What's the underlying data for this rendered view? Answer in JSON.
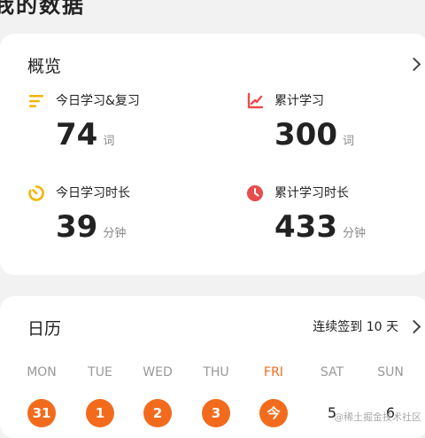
{
  "page": {
    "title": "我的数据"
  },
  "overview": {
    "title": "概览",
    "stats": [
      {
        "label": "今日学习&复习",
        "value": "74",
        "unit": "词",
        "icon": "list-lines-icon",
        "color": "#f5b400"
      },
      {
        "label": "累计学习",
        "value": "300",
        "unit": "词",
        "icon": "line-chart-icon",
        "color": "#e84c4c"
      },
      {
        "label": "今日学习时长",
        "value": "39",
        "unit": "分钟",
        "icon": "progress-ring-icon",
        "color": "#f5b400"
      },
      {
        "label": "累计学习时长",
        "value": "433",
        "unit": "分钟",
        "icon": "clock-icon",
        "color": "#e84c4c"
      }
    ]
  },
  "calendar": {
    "title": "日历",
    "streak": "连续签到 10 天",
    "weekdays": [
      "MON",
      "TUE",
      "WED",
      "THU",
      "FRI",
      "SAT",
      "SUN"
    ],
    "today_index": 4,
    "days": [
      {
        "label": "31",
        "checked": true
      },
      {
        "label": "1",
        "checked": true
      },
      {
        "label": "2",
        "checked": true
      },
      {
        "label": "3",
        "checked": true
      },
      {
        "label": "今",
        "checked": true
      },
      {
        "label": "5",
        "checked": false
      },
      {
        "label": "6",
        "checked": false
      }
    ],
    "accent": "#f26b1d"
  },
  "watermark": "@稀土掘金技术社区"
}
